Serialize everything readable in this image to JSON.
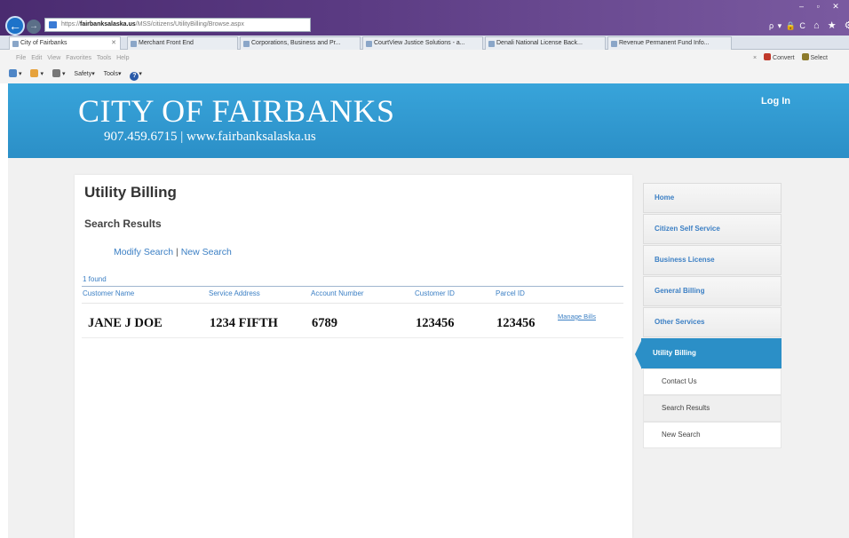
{
  "browser": {
    "address_scheme": "https://",
    "address_host": "fairbanksalaska.us",
    "address_path": "/MSS/citizens/UtilityBilling/Browse.aspx",
    "search_controls": "ρ ▾ 🔒 C",
    "window_controls": "– ▫ ✕",
    "right_icons": "⌂ ★ ⚙",
    "tabs": [
      {
        "label": "City of Fairbanks",
        "close": "✕"
      },
      {
        "label": "Merchant Front End",
        "close": ""
      },
      {
        "label": "Corporations, Business and Pr...",
        "close": ""
      },
      {
        "label": "CourtView Justice Solutions - a...",
        "close": ""
      },
      {
        "label": "Denali National License Back...",
        "close": ""
      },
      {
        "label": "Revenue Permanent Fund Info...",
        "close": ""
      }
    ],
    "menu": "File  Edit  View  Favorites  Tools  Help",
    "menu_right": {
      "close": "×",
      "convert": "Convert",
      "select": "Select"
    },
    "commands": {
      "safety": "Safety",
      "tools": "Tools"
    }
  },
  "header": {
    "city_name": "CITY OF FAIRBANKS",
    "contact": "907.459.6715 | www.fairbanksalaska.us",
    "login": "Log In"
  },
  "content": {
    "title": "Utility Billing",
    "subtitle": "Search Results",
    "modify_search": "Modify Search",
    "link_separator": " | ",
    "new_search": "New Search",
    "found_count": "1 found",
    "columns": [
      "Customer Name",
      "Service Address",
      "Account Number",
      "Customer ID",
      "Parcel ID"
    ],
    "row": {
      "customer_name": "JANE J DOE",
      "service_address": "1234 FIFTH",
      "account_number": "6789",
      "customer_id": "123456",
      "parcel_id": "123456",
      "action": "Manage Bills"
    }
  },
  "sidebar": {
    "items": [
      {
        "label": "Home"
      },
      {
        "label": "Citizen Self Service"
      },
      {
        "label": "Business License"
      },
      {
        "label": "General Billing"
      },
      {
        "label": "Other Services"
      },
      {
        "label": "Utility Billing"
      }
    ],
    "subitems": [
      {
        "label": "Contact Us"
      },
      {
        "label": "Search Results"
      },
      {
        "label": "New Search"
      }
    ]
  },
  "colors": {
    "header_blue": "#2b8fc7",
    "link_blue": "#3b7fc4",
    "titlebar_purple": "#5a3a82"
  }
}
